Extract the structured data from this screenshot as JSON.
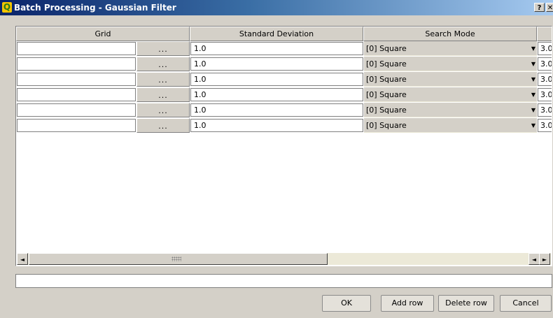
{
  "window": {
    "title": "Batch Processing - Gaussian Filter",
    "help_label": "?",
    "close_label": "✕"
  },
  "table": {
    "headers": [
      "Grid",
      "Standard Deviation",
      "Search Mode"
    ],
    "browse_label": "...",
    "rows": [
      {
        "grid": "",
        "std": "1.0",
        "mode": "[0] Square",
        "extra": "3.0"
      },
      {
        "grid": "",
        "std": "1.0",
        "mode": "[0] Square",
        "extra": "3.0"
      },
      {
        "grid": "",
        "std": "1.0",
        "mode": "[0] Square",
        "extra": "3.0"
      },
      {
        "grid": "",
        "std": "1.0",
        "mode": "[0] Square",
        "extra": "3.0"
      },
      {
        "grid": "",
        "std": "1.0",
        "mode": "[0] Square",
        "extra": "3.0"
      },
      {
        "grid": "",
        "std": "1.0",
        "mode": "[0] Square",
        "extra": "3.0"
      }
    ]
  },
  "scrollbar": {
    "left_glyph": "◄",
    "right_glyph": "►"
  },
  "progress": {
    "value": 0
  },
  "buttons": {
    "ok": "OK",
    "add_row": "Add row",
    "delete_row": "Delete row",
    "cancel": "Cancel"
  },
  "colors": {
    "titlebar_start": "#0a246a",
    "titlebar_end": "#a6caf0",
    "face": "#d4d0c8"
  }
}
